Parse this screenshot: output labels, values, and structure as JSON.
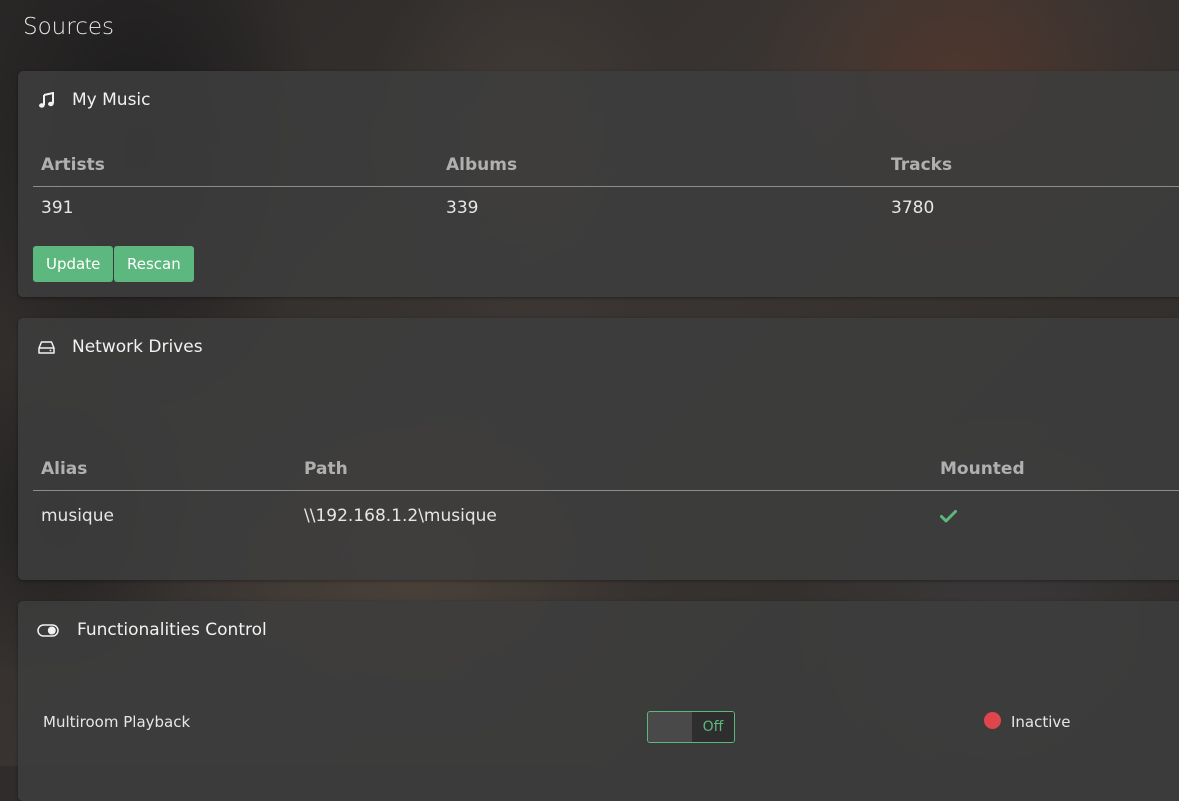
{
  "page": {
    "title": "Sources"
  },
  "colors": {
    "accent": "#5cb87e",
    "inactive": "#e0454b",
    "panel": "#3e3e3e"
  },
  "my_music": {
    "icon": "music-note-icon",
    "title": "My Music",
    "columns": [
      "Artists",
      "Albums",
      "Tracks"
    ],
    "rows": [
      [
        "391",
        "339",
        "3780"
      ]
    ],
    "buttons": {
      "update": "Update",
      "rescan": "Rescan"
    }
  },
  "network_drives": {
    "icon": "hard-drive-icon",
    "title": "Network Drives",
    "columns": [
      "Alias",
      "Path",
      "Mounted"
    ],
    "rows": [
      {
        "alias": "musique",
        "path": "\\\\192.168.1.2\\musique",
        "mounted_icon": "checkmark-icon"
      }
    ]
  },
  "functionalities": {
    "icon": "toggle-icon",
    "title": "Functionalities Control",
    "items": [
      {
        "label": "Multiroom Playback",
        "toggle": "Off",
        "status": "Inactive"
      }
    ]
  }
}
